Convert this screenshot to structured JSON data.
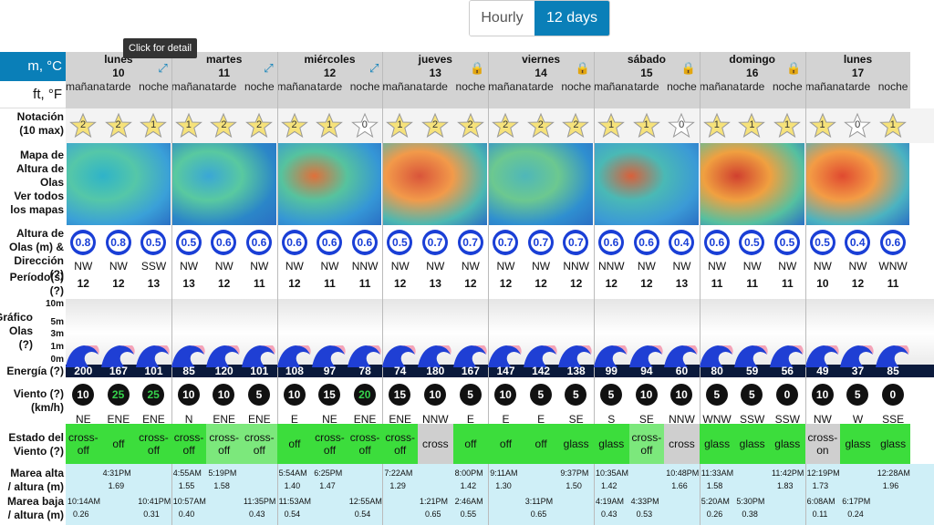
{
  "toggle": {
    "hourly": "Hourly",
    "days": "12 days"
  },
  "units": {
    "metric": "m, °C",
    "imperial": "ft, °F"
  },
  "tooltip": "Click for detail",
  "labels": {
    "rating": "Notación\n(10 max)",
    "map": "Mapa de\nAltura de\nOlas",
    "maps_link": "Ver todos\nlos mapas",
    "wave_height": "Altura de\nOlas (m) &\nDirección (?)",
    "period": "Período(s)\n(?)",
    "graph": "Gráfico\nOlas\n(?)",
    "energy": "Energía (?)",
    "wind": "Viento (?)\n(km/h)",
    "wind_state": "Estado del\nViento (?)",
    "high_tide": "Marea alta\n/ altura (m)",
    "low_tide": "Marea baja\n/ altura (m)"
  },
  "graph_ticks": [
    "10m",
    "5m",
    "3m",
    "1m",
    "0m"
  ],
  "periods": [
    "mañana",
    "tarde",
    "noche"
  ],
  "days": [
    {
      "name": "lunes",
      "num": "10",
      "icon": "expand-icon"
    },
    {
      "name": "martes",
      "num": "11",
      "icon": "expand-icon"
    },
    {
      "name": "miércoles",
      "num": "12",
      "icon": "expand-icon"
    },
    {
      "name": "jueves",
      "num": "13",
      "icon": "lock-icon"
    },
    {
      "name": "viernes",
      "num": "14",
      "icon": "lock-icon"
    },
    {
      "name": "sábado",
      "num": "15",
      "icon": "lock-icon"
    },
    {
      "name": "domingo",
      "num": "16",
      "icon": "lock-icon"
    },
    {
      "name": "lunes",
      "num": "17",
      "icon": ""
    }
  ],
  "slots": [
    {
      "star": "2",
      "wave": "0.8",
      "dir": "NW",
      "per": "12",
      "energy": "200",
      "wind": "10",
      "wdir": "NE",
      "state": "cross-off",
      "sclass": "st-green"
    },
    {
      "star": "2",
      "wave": "0.8",
      "dir": "NW",
      "per": "12",
      "energy": "167",
      "wind": "25",
      "wdir": "ENE",
      "state": "off",
      "sclass": "st-green",
      "wg": true
    },
    {
      "star": "1",
      "wave": "0.5",
      "dir": "SSW",
      "per": "13",
      "energy": "101",
      "wind": "25",
      "wdir": "ENE",
      "state": "cross-off",
      "sclass": "st-green",
      "wg": true
    },
    {
      "star": "1",
      "wave": "0.5",
      "dir": "NW",
      "per": "13",
      "energy": "85",
      "wind": "10",
      "wdir": "N",
      "state": "cross-off",
      "sclass": "st-green"
    },
    {
      "star": "2",
      "wave": "0.6",
      "dir": "NW",
      "per": "12",
      "energy": "120",
      "wind": "10",
      "wdir": "ENE",
      "state": "cross-off",
      "sclass": "st-lgreen"
    },
    {
      "star": "2",
      "wave": "0.6",
      "dir": "NW",
      "per": "11",
      "energy": "101",
      "wind": "5",
      "wdir": "ENE",
      "state": "cross-off",
      "sclass": "st-lgreen"
    },
    {
      "star": "2",
      "wave": "0.6",
      "dir": "NW",
      "per": "12",
      "energy": "108",
      "wind": "10",
      "wdir": "E",
      "state": "off",
      "sclass": "st-green"
    },
    {
      "star": "1",
      "wave": "0.6",
      "dir": "NW",
      "per": "11",
      "energy": "97",
      "wind": "15",
      "wdir": "NE",
      "state": "cross-off",
      "sclass": "st-green"
    },
    {
      "star": "0",
      "wave": "0.6",
      "dir": "NNW",
      "per": "11",
      "energy": "78",
      "wind": "20",
      "wdir": "ENE",
      "state": "cross-off",
      "sclass": "st-green",
      "wg": true
    },
    {
      "star": "1",
      "wave": "0.5",
      "dir": "NW",
      "per": "12",
      "energy": "74",
      "wind": "15",
      "wdir": "ENE",
      "state": "cross-off",
      "sclass": "st-green"
    },
    {
      "star": "2",
      "wave": "0.7",
      "dir": "NW",
      "per": "13",
      "energy": "180",
      "wind": "10",
      "wdir": "NNW",
      "state": "cross",
      "sclass": "st-gray"
    },
    {
      "star": "2",
      "wave": "0.7",
      "dir": "NW",
      "per": "12",
      "energy": "167",
      "wind": "5",
      "wdir": "E",
      "state": "off",
      "sclass": "st-green"
    },
    {
      "star": "2",
      "wave": "0.7",
      "dir": "NW",
      "per": "12",
      "energy": "147",
      "wind": "10",
      "wdir": "E",
      "state": "off",
      "sclass": "st-green"
    },
    {
      "star": "2",
      "wave": "0.7",
      "dir": "NW",
      "per": "12",
      "energy": "142",
      "wind": "5",
      "wdir": "E",
      "state": "off",
      "sclass": "st-green"
    },
    {
      "star": "2",
      "wave": "0.7",
      "dir": "NNW",
      "per": "12",
      "energy": "138",
      "wind": "5",
      "wdir": "SE",
      "state": "glass",
      "sclass": "st-green"
    },
    {
      "star": "1",
      "wave": "0.6",
      "dir": "NNW",
      "per": "12",
      "energy": "99",
      "wind": "5",
      "wdir": "S",
      "state": "glass",
      "sclass": "st-green"
    },
    {
      "star": "1",
      "wave": "0.6",
      "dir": "NW",
      "per": "12",
      "energy": "94",
      "wind": "10",
      "wdir": "SE",
      "state": "cross-off",
      "sclass": "st-lgreen"
    },
    {
      "star": "0",
      "wave": "0.4",
      "dir": "NW",
      "per": "13",
      "energy": "60",
      "wind": "10",
      "wdir": "NNW",
      "state": "cross",
      "sclass": "st-gray"
    },
    {
      "star": "1",
      "wave": "0.6",
      "dir": "NW",
      "per": "11",
      "energy": "80",
      "wind": "5",
      "wdir": "WNW",
      "state": "glass",
      "sclass": "st-green"
    },
    {
      "star": "1",
      "wave": "0.5",
      "dir": "NW",
      "per": "11",
      "energy": "59",
      "wind": "5",
      "wdir": "SSW",
      "state": "glass",
      "sclass": "st-green"
    },
    {
      "star": "1",
      "wave": "0.5",
      "dir": "NW",
      "per": "11",
      "energy": "56",
      "wind": "0",
      "wdir": "SSW",
      "state": "glass",
      "sclass": "st-green"
    },
    {
      "star": "1",
      "wave": "0.5",
      "dir": "NW",
      "per": "10",
      "energy": "49",
      "wind": "10",
      "wdir": "NW",
      "state": "cross-on",
      "sclass": "st-gray"
    },
    {
      "star": "0",
      "wave": "0.4",
      "dir": "NW",
      "per": "12",
      "energy": "37",
      "wind": "5",
      "wdir": "W",
      "state": "glass",
      "sclass": "st-green"
    },
    {
      "star": "1",
      "wave": "0.6",
      "dir": "WNW",
      "per": "11",
      "energy": "85",
      "wind": "0",
      "wdir": "SSE",
      "state": "glass",
      "sclass": "st-green"
    }
  ],
  "tides_high": [
    {
      "t": "4:31PM",
      "h": "1.69",
      "slot": 1
    },
    {
      "t": "4:55AM",
      "h": "1.55",
      "slot": 3
    },
    {
      "t": "5:19PM",
      "h": "1.58",
      "slot": 4
    },
    {
      "t": "5:54AM",
      "h": "1.40",
      "slot": 6
    },
    {
      "t": "6:25PM",
      "h": "1.47",
      "slot": 7
    },
    {
      "t": "7:22AM",
      "h": "1.29",
      "slot": 9
    },
    {
      "t": "8:00PM",
      "h": "1.42",
      "slot": 11
    },
    {
      "t": "9:11AM",
      "h": "1.30",
      "slot": 12
    },
    {
      "t": "9:37PM",
      "h": "1.50",
      "slot": 14
    },
    {
      "t": "10:35AM",
      "h": "1.42",
      "slot": 15
    },
    {
      "t": "10:48PM",
      "h": "1.66",
      "slot": 17
    },
    {
      "t": "11:33AM",
      "h": "1.58",
      "slot": 18
    },
    {
      "t": "11:42PM",
      "h": "1.83",
      "slot": 20
    },
    {
      "t": "12:19PM",
      "h": "1.73",
      "slot": 21
    },
    {
      "t": "12:28AM",
      "h": "1.96",
      "slot": 23
    }
  ],
  "tides_low": [
    {
      "t": "10:14AM",
      "h": "0.26",
      "slot": 0
    },
    {
      "t": "10:41PM",
      "h": "0.31",
      "slot": 2
    },
    {
      "t": "10:57AM",
      "h": "0.40",
      "slot": 3
    },
    {
      "t": "11:35PM",
      "h": "0.43",
      "slot": 5
    },
    {
      "t": "11:53AM",
      "h": "0.54",
      "slot": 6
    },
    {
      "t": "12:55AM",
      "h": "0.54",
      "slot": 8
    },
    {
      "t": "1:21PM",
      "h": "0.65",
      "slot": 10
    },
    {
      "t": "2:46AM",
      "h": "0.55",
      "slot": 11
    },
    {
      "t": "3:11PM",
      "h": "0.65",
      "slot": 13
    },
    {
      "t": "4:19AM",
      "h": "0.43",
      "slot": 15
    },
    {
      "t": "4:33PM",
      "h": "0.53",
      "slot": 16
    },
    {
      "t": "5:20AM",
      "h": "0.26",
      "slot": 18
    },
    {
      "t": "5:30PM",
      "h": "0.38",
      "slot": 19
    },
    {
      "t": "6:08AM",
      "h": "0.11",
      "slot": 21
    },
    {
      "t": "6:17PM",
      "h": "0.24",
      "slot": 22
    }
  ]
}
